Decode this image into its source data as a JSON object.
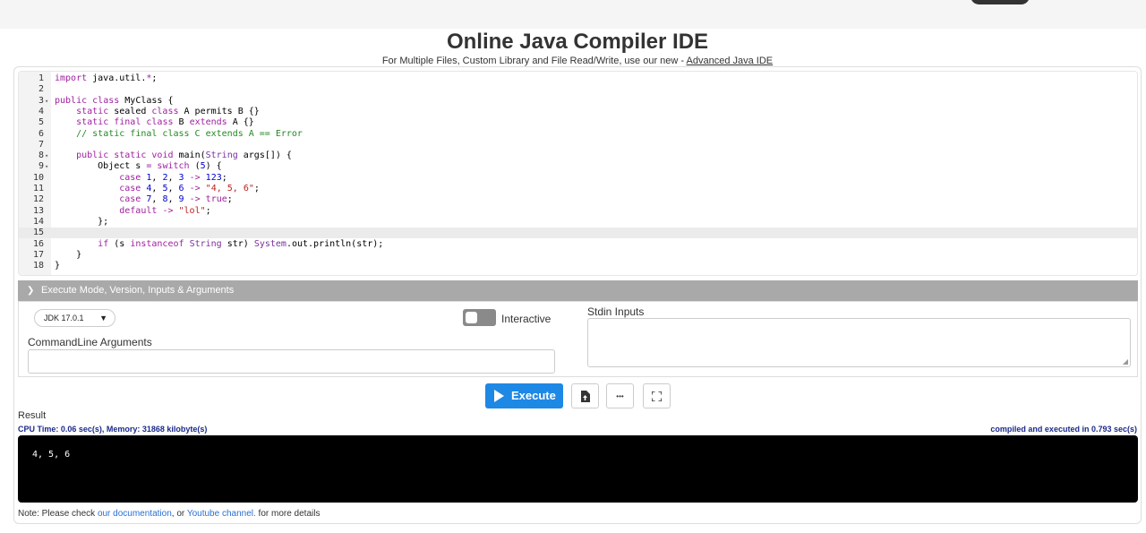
{
  "page": {
    "title": "Online Java Compiler IDE",
    "subtitle_prefix": "For Multiple Files, Custom Library and File Read/Write, use our new - ",
    "subtitle_link": "Advanced Java IDE"
  },
  "editor": {
    "active_line": 15,
    "lines": [
      {
        "n": "1",
        "fold": false,
        "html": "<span class=\"kw\">import</span> java.util.<span class=\"kw\">*</span>;"
      },
      {
        "n": "2",
        "fold": false,
        "html": ""
      },
      {
        "n": "3",
        "fold": true,
        "html": "<span class=\"kw\">public</span> <span class=\"kw\">class</span> MyClass {"
      },
      {
        "n": "4",
        "fold": false,
        "html": "    <span class=\"kw\">static</span> sealed <span class=\"kw\">class</span> A permits B {}"
      },
      {
        "n": "5",
        "fold": false,
        "html": "    <span class=\"kw\">static</span> <span class=\"kw\">final</span> <span class=\"kw\">class</span> B <span class=\"kw\">extends</span> A {}"
      },
      {
        "n": "6",
        "fold": false,
        "html": "    <span class=\"cmt\">// static final class C extends A == Error</span>"
      },
      {
        "n": "7",
        "fold": false,
        "html": ""
      },
      {
        "n": "8",
        "fold": true,
        "html": "    <span class=\"kw\">public</span> <span class=\"kw\">static</span> <span class=\"kw\">void</span> main(<span class=\"typ\">String</span> args[]) {"
      },
      {
        "n": "9",
        "fold": true,
        "html": "        Object s <span class=\"kw\">=</span> <span class=\"kw\">switch</span> (<span class=\"num\">5</span>) {"
      },
      {
        "n": "10",
        "fold": false,
        "html": "            <span class=\"kw\">case</span> <span class=\"num\">1</span>, <span class=\"num\">2</span>, <span class=\"num\">3</span> <span class=\"kw\">-></span> <span class=\"num\">123</span>;"
      },
      {
        "n": "11",
        "fold": false,
        "html": "            <span class=\"kw\">case</span> <span class=\"num\">4</span>, <span class=\"num\">5</span>, <span class=\"num\">6</span> <span class=\"kw\">-></span> <span class=\"str\">\"4, 5, 6\"</span>;"
      },
      {
        "n": "12",
        "fold": false,
        "html": "            <span class=\"kw\">case</span> <span class=\"num\">7</span>, <span class=\"num\">8</span>, <span class=\"num\">9</span> <span class=\"kw\">-></span> <span class=\"kw\">true</span>;"
      },
      {
        "n": "13",
        "fold": false,
        "html": "            <span class=\"kw\">default</span> <span class=\"kw\">-></span> <span class=\"str\">\"lol\"</span>;"
      },
      {
        "n": "14",
        "fold": false,
        "html": "        };"
      },
      {
        "n": "15",
        "fold": false,
        "html": ""
      },
      {
        "n": "16",
        "fold": false,
        "html": "        <span class=\"kw\">if</span> (s <span class=\"kw\">instanceof</span> <span class=\"typ\">String</span> str) <span class=\"typ\">System</span>.out.println(str);"
      },
      {
        "n": "17",
        "fold": false,
        "html": "    }"
      },
      {
        "n": "18",
        "fold": false,
        "html": "}"
      }
    ]
  },
  "settings": {
    "header": "Execute Mode, Version, Inputs & Arguments",
    "jdk_value": "JDK 17.0.1",
    "interactive_label": "Interactive",
    "interactive_on": false,
    "cmdline_label": "CommandLine Arguments",
    "cmdline_value": "",
    "stdin_label": "Stdin Inputs",
    "stdin_value": ""
  },
  "toolbar": {
    "execute_label": "Execute",
    "ellipsis": "•••"
  },
  "result": {
    "label": "Result",
    "cpu": "CPU Time: 0.06 sec(s), Memory: 31868 kilobyte(s)",
    "compiled": "compiled and executed in 0.793 sec(s)",
    "output": "4, 5, 6"
  },
  "note": {
    "prefix": "Note: Please check ",
    "doc_link": "our documentation",
    "middle": ", or ",
    "yt_link": "Youtube channel.",
    "suffix": " for more details"
  },
  "colors": {
    "accent": "#1e88e5",
    "section_header": "#a9a9a9",
    "output_bg": "#000000",
    "stat_text": "#1a2a8a"
  }
}
